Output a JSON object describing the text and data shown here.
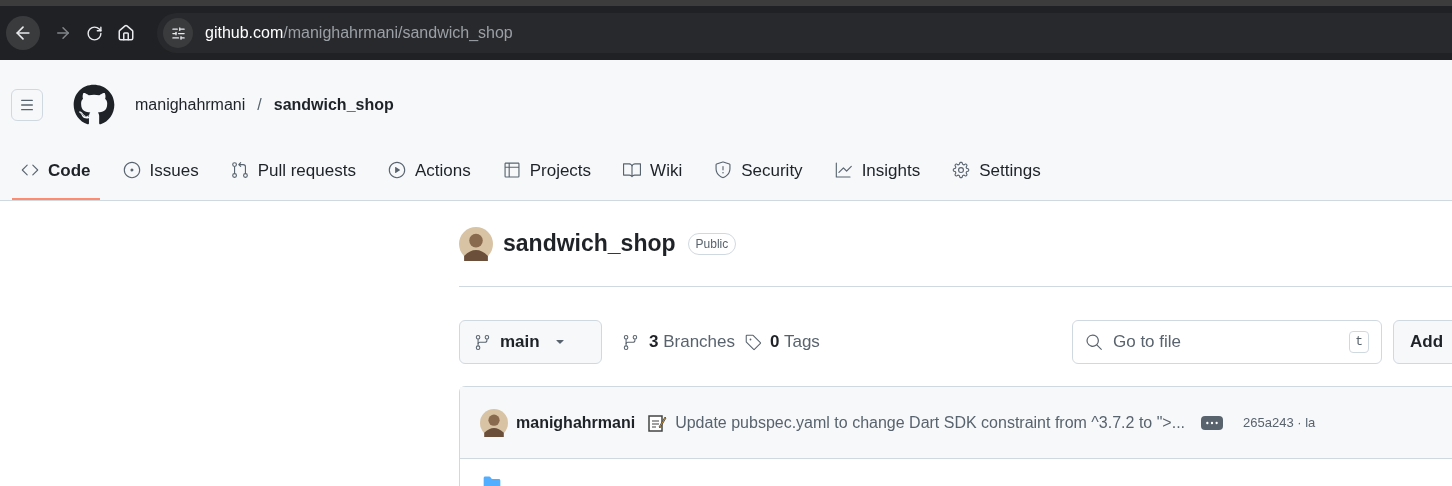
{
  "browser": {
    "url_host": "github.com",
    "url_path": "/manighahrmani/sandwich_shop"
  },
  "header": {
    "owner": "manighahrmani",
    "separator": "/",
    "repo": "sandwich_shop"
  },
  "tabs": [
    {
      "label": "Code",
      "selected": true
    },
    {
      "label": "Issues",
      "selected": false
    },
    {
      "label": "Pull requests",
      "selected": false
    },
    {
      "label": "Actions",
      "selected": false
    },
    {
      "label": "Projects",
      "selected": false
    },
    {
      "label": "Wiki",
      "selected": false
    },
    {
      "label": "Security",
      "selected": false
    },
    {
      "label": "Insights",
      "selected": false
    },
    {
      "label": "Settings",
      "selected": false
    }
  ],
  "repo": {
    "title": "sandwich_shop",
    "visibility": "Public"
  },
  "toolbar": {
    "branch": "main",
    "branches_count": "3",
    "branches_label": "Branches",
    "tags_count": "0",
    "tags_label": "Tags",
    "search_placeholder": "Go to file",
    "shortcut": "t",
    "add_button": "Add"
  },
  "commit": {
    "author": "manighahrmani",
    "message": "Update pubspec.yaml to change Dart SDK constraint from ^3.7.2 to \">...",
    "hash": "265a243 · la"
  }
}
